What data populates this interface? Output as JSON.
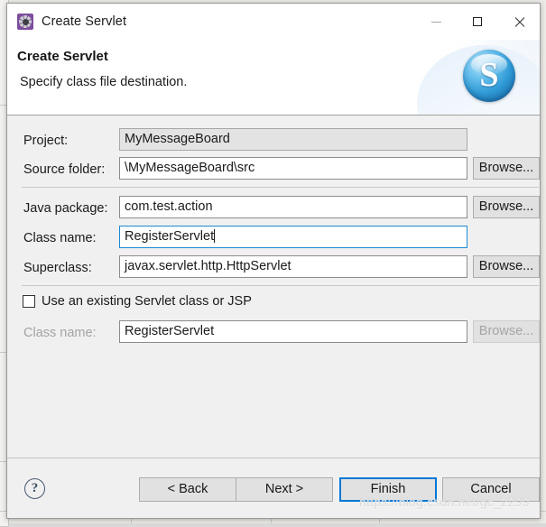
{
  "window": {
    "title": "Create Servlet",
    "icon": "servlet-gear-icon",
    "minimize_label": "Minimize",
    "maximize_label": "Maximize",
    "close_label": "Close"
  },
  "header": {
    "title": "Create Servlet",
    "description": "Specify class file destination.",
    "logo_letter": "S"
  },
  "form": {
    "project": {
      "label": "Project:",
      "value": "MyMessageBoard"
    },
    "source_folder": {
      "label": "Source folder:",
      "value": "\\MyMessageBoard\\src",
      "browse_label": "Browse..."
    },
    "java_package": {
      "label": "Java package:",
      "value": "com.test.action",
      "browse_label": "Browse..."
    },
    "class_name": {
      "label": "Class name:",
      "value": "RegisterServlet"
    },
    "superclass": {
      "label": "Superclass:",
      "value": "javax.servlet.http.HttpServlet",
      "browse_label": "Browse..."
    },
    "use_existing": {
      "label": "Use an existing Servlet class or JSP",
      "checked": false
    },
    "existing_class_name": {
      "label": "Class name:",
      "value": "RegisterServlet",
      "browse_label": "Browse...",
      "disabled": true
    }
  },
  "footer": {
    "help_label": "?",
    "back_label": "< Back",
    "next_label": "Next >",
    "finish_label": "Finish",
    "cancel_label": "Cancel"
  },
  "watermark": {
    "text": "https://blog.csdn.net/gc_2299"
  },
  "colors": {
    "accent": "#0078d7",
    "focus_border": "#1a8ad4",
    "dialog_bg": "#f0f0f0",
    "header_bg": "#ffffff",
    "title_icon": "#7d4d9e"
  }
}
